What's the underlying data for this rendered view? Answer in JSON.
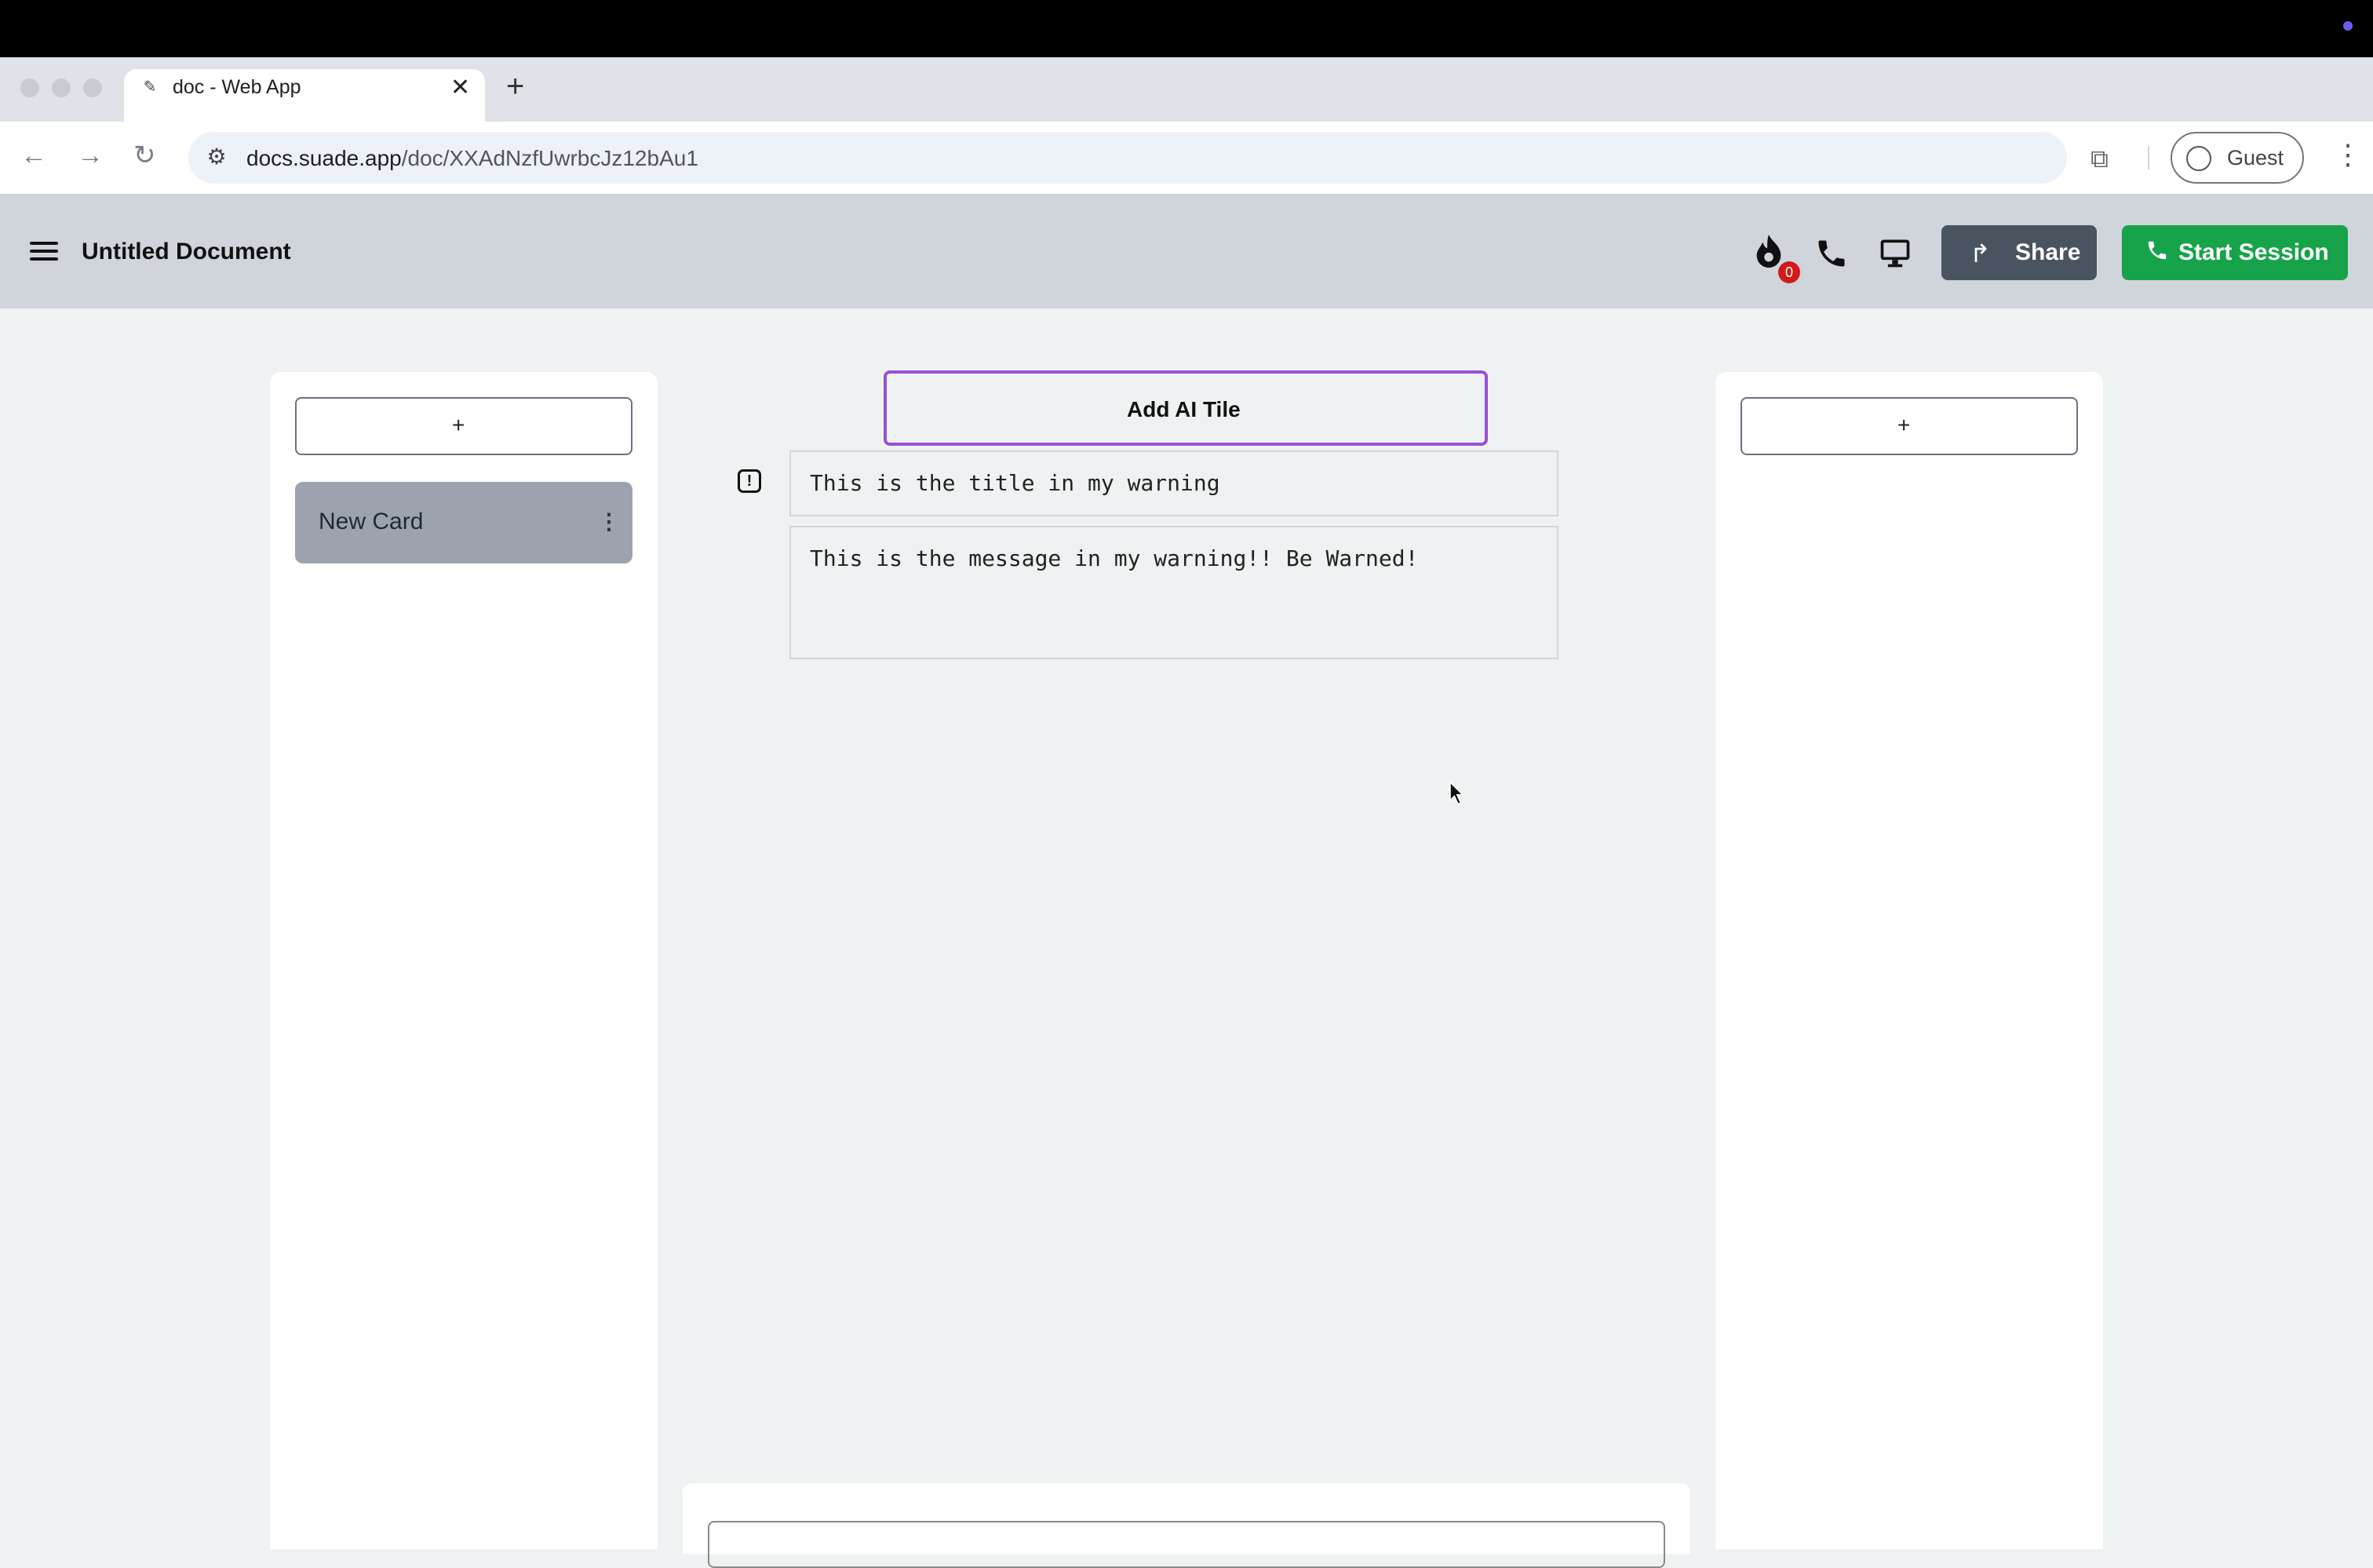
{
  "browser": {
    "tab": {
      "title": "doc - Web App",
      "close_glyph": "✕",
      "favicon": "pen-icon"
    },
    "new_tab_glyph": "+",
    "nav": {
      "back": "←",
      "forward": "→",
      "reload": "↻"
    },
    "address": {
      "host": "docs.suade.app",
      "path": "/doc/XXAdNzfUwrbcJz12bAu1"
    },
    "profile_label": "Guest",
    "menu_glyph": "⋮"
  },
  "app": {
    "doc_title": "Untitled Document",
    "streak_count": "0",
    "share_label": "Share",
    "start_session_label": "Start Session",
    "accent_green": "#17a34a",
    "badge_red": "#d11a1a"
  },
  "left_column": {
    "add_label": "+",
    "cards": [
      {
        "label": "New Card",
        "menu_glyph": "⋮"
      }
    ]
  },
  "center": {
    "add_ai_tile_label": "Add AI Tile",
    "warning": {
      "icon_glyph": "!",
      "title": "This is the title in my warning",
      "message": "This is the message in my warning!! Be Warned!"
    }
  },
  "right_column": {
    "add_label": "+"
  }
}
